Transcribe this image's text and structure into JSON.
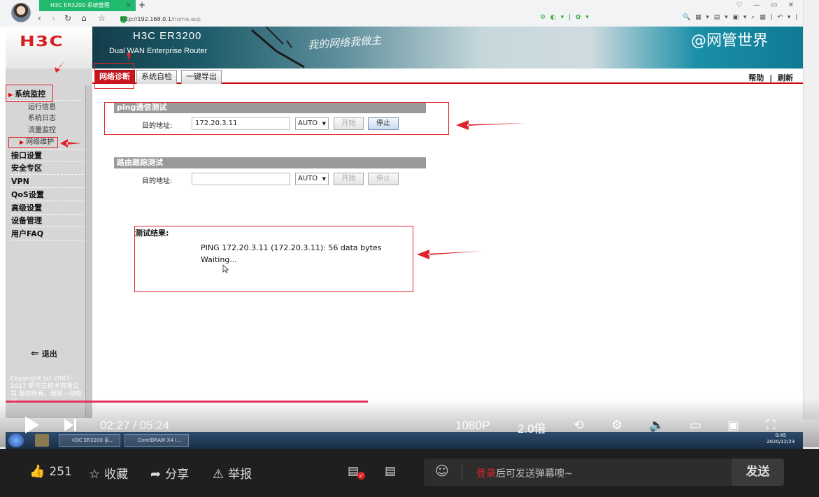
{
  "browser": {
    "tab_title": "H3C ER3200 系统管理",
    "url_host": "http://192.168.0.1",
    "url_path": "/home.asp",
    "new_tab": "+",
    "close_tab": "×",
    "window_controls": "♡ — ▭ ✕"
  },
  "header": {
    "logo_text": "H3C",
    "product": "H3C ER3200",
    "subtitle": "Dual WAN Enterprise Router",
    "slogan": "我的网络我做主",
    "watermark": "@网管世界"
  },
  "tabs": [
    {
      "label": "网络诊断",
      "active": true
    },
    {
      "label": "系统自检",
      "active": false
    },
    {
      "label": "一键导出",
      "active": false
    }
  ],
  "top_links": {
    "help": "帮助",
    "sep": "|",
    "refresh": "刷新"
  },
  "sidebar": {
    "menu": [
      {
        "label": "系统监控"
      },
      {
        "label": "接口设置"
      },
      {
        "label": "安全专区"
      },
      {
        "label": "VPN"
      },
      {
        "label": "QoS设置"
      },
      {
        "label": "高级设置"
      },
      {
        "label": "设备管理"
      },
      {
        "label": "用户FAQ"
      }
    ],
    "submenu": [
      {
        "label": "运行信息"
      },
      {
        "label": "系统日志"
      },
      {
        "label": "流量监控"
      },
      {
        "label": "网络维护"
      }
    ],
    "logout": "退出",
    "copyright": "Copyright (c) 2007-2017 新华三技术有限公司 版权所有，保留一切权利"
  },
  "ping": {
    "title": "ping通信测试",
    "dest_label": "目的地址:",
    "dest_value": "172.20.3.11",
    "mode": "AUTO",
    "start": "开始",
    "stop": "停止"
  },
  "trace": {
    "title": "路由跟踪测试",
    "dest_label": "目的地址:",
    "dest_value": "",
    "mode": "AUTO",
    "start": "开始",
    "stop": "停止"
  },
  "result": {
    "title": "测试结果:",
    "lines": "PING 172.20.3.11 (172.20.3.11): 56 data bytes\nWaiting..."
  },
  "video": {
    "current": "02:27",
    "sep": " / ",
    "total": "05:24",
    "progress_pct": 45.4,
    "quality": "1080P",
    "speed": "2.0倍",
    "progress_color": "#e4335a"
  },
  "taskbar": {
    "item1": "H3C ER3200 系...",
    "item2": "CorelDRAW X4 (...",
    "time": "0:45",
    "date": "2020/12/23"
  },
  "actions": {
    "like": "251",
    "favorite": "收藏",
    "share": "分享",
    "report": "举报"
  },
  "danmu": {
    "login": "登录",
    "placeholder": "后可发送弹幕噢~",
    "send": "发送"
  }
}
